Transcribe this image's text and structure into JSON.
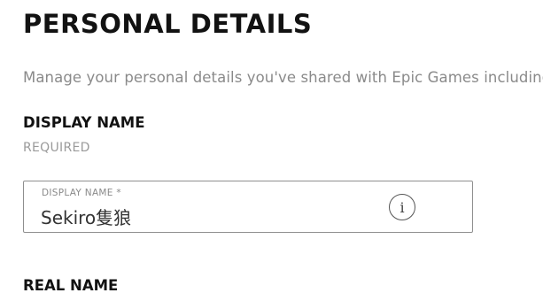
{
  "page": {
    "title": "PERSONAL DETAILS",
    "description": "Manage your personal details you've shared with Epic Games including"
  },
  "display_name_section": {
    "heading": "DISPLAY NAME",
    "required_note": "REQUIRED",
    "field": {
      "label": "DISPLAY NAME *",
      "value": "Sekiro隻狼",
      "info_icon_glyph": "i",
      "info_icon_name": "info-icon"
    }
  },
  "real_name_section": {
    "heading": "REAL NAME"
  },
  "colors": {
    "text_primary": "#121212",
    "text_muted": "#8a8a8a",
    "field_border": "#8f8f8f",
    "background": "#ffffff"
  }
}
